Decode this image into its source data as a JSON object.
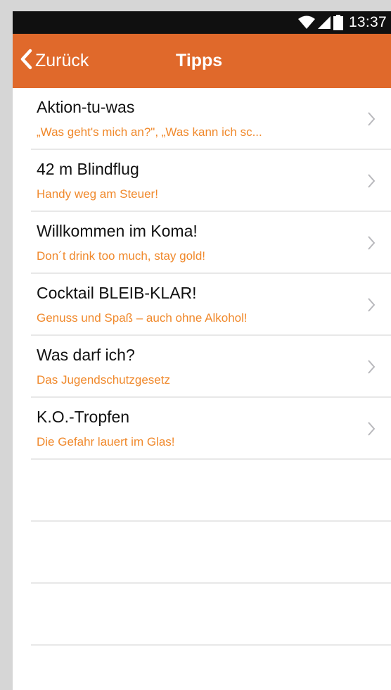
{
  "status_bar": {
    "time": "13:37",
    "icons": [
      "wifi-icon",
      "signal-icon",
      "battery-icon"
    ]
  },
  "nav": {
    "back_label": "Zurück",
    "title": "Tipps",
    "back_icon": "chevron-left-icon"
  },
  "colors": {
    "nav_bar": "#e0692b",
    "subtitle": "#f0892c",
    "status_bar": "#101010"
  },
  "items": [
    {
      "title": "Aktion-tu-was",
      "subtitle": "„Was geht's mich an?\", „Was kann ich sc..."
    },
    {
      "title": "42 m Blindflug",
      "subtitle": "Handy weg am Steuer!"
    },
    {
      "title": "Willkommen im Koma!",
      "subtitle": "Don´t drink too much, stay gold!"
    },
    {
      "title": "Cocktail BLEIB-KLAR!",
      "subtitle": "Genuss und Spaß – auch ohne Alkohol!"
    },
    {
      "title": "Was darf ich?",
      "subtitle": "Das Jugendschutzgesetz"
    },
    {
      "title": "K.O.-Tropfen",
      "subtitle": "Die Gefahr lauert im Glas!"
    }
  ]
}
